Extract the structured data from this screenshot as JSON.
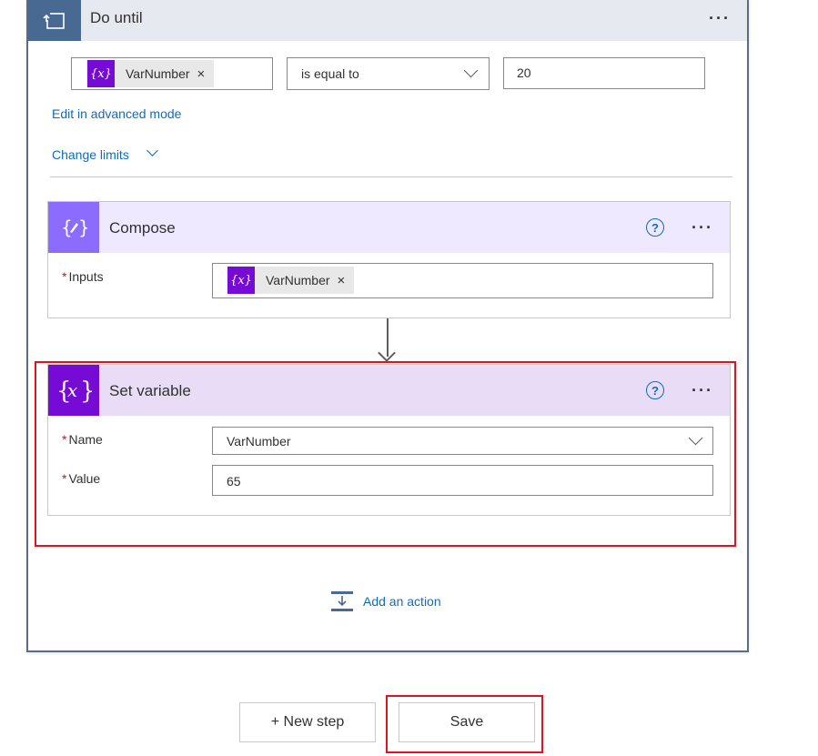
{
  "do_until": {
    "title": "Do until",
    "condition": {
      "token_label": "VarNumber",
      "token_remove": "×",
      "operator": "is equal to",
      "value": "20"
    },
    "edit_advanced_label": "Edit in advanced mode",
    "change_limits_label": "Change limits",
    "more_label": "···"
  },
  "compose": {
    "title": "Compose",
    "help": "?",
    "more_label": "···",
    "inputs_required_marker": "*",
    "inputs_label": "Inputs",
    "inputs_token_label": "VarNumber",
    "inputs_token_remove": "×"
  },
  "set_variable": {
    "title": "Set variable",
    "help": "?",
    "more_label": "···",
    "name_required_marker": "*",
    "name_label": "Name",
    "name_value": "VarNumber",
    "value_required_marker": "*",
    "value_label": "Value",
    "value_value": "65"
  },
  "add_action_label": "Add an action",
  "footer": {
    "new_step_label": "+ New step",
    "save_label": "Save"
  },
  "colors": {
    "variable_purple": "#770bd6",
    "compose_purple": "#8c6cff",
    "loop_blue": "#486991",
    "link_blue": "#0f6cbd",
    "highlight_red": "#e0141e"
  }
}
